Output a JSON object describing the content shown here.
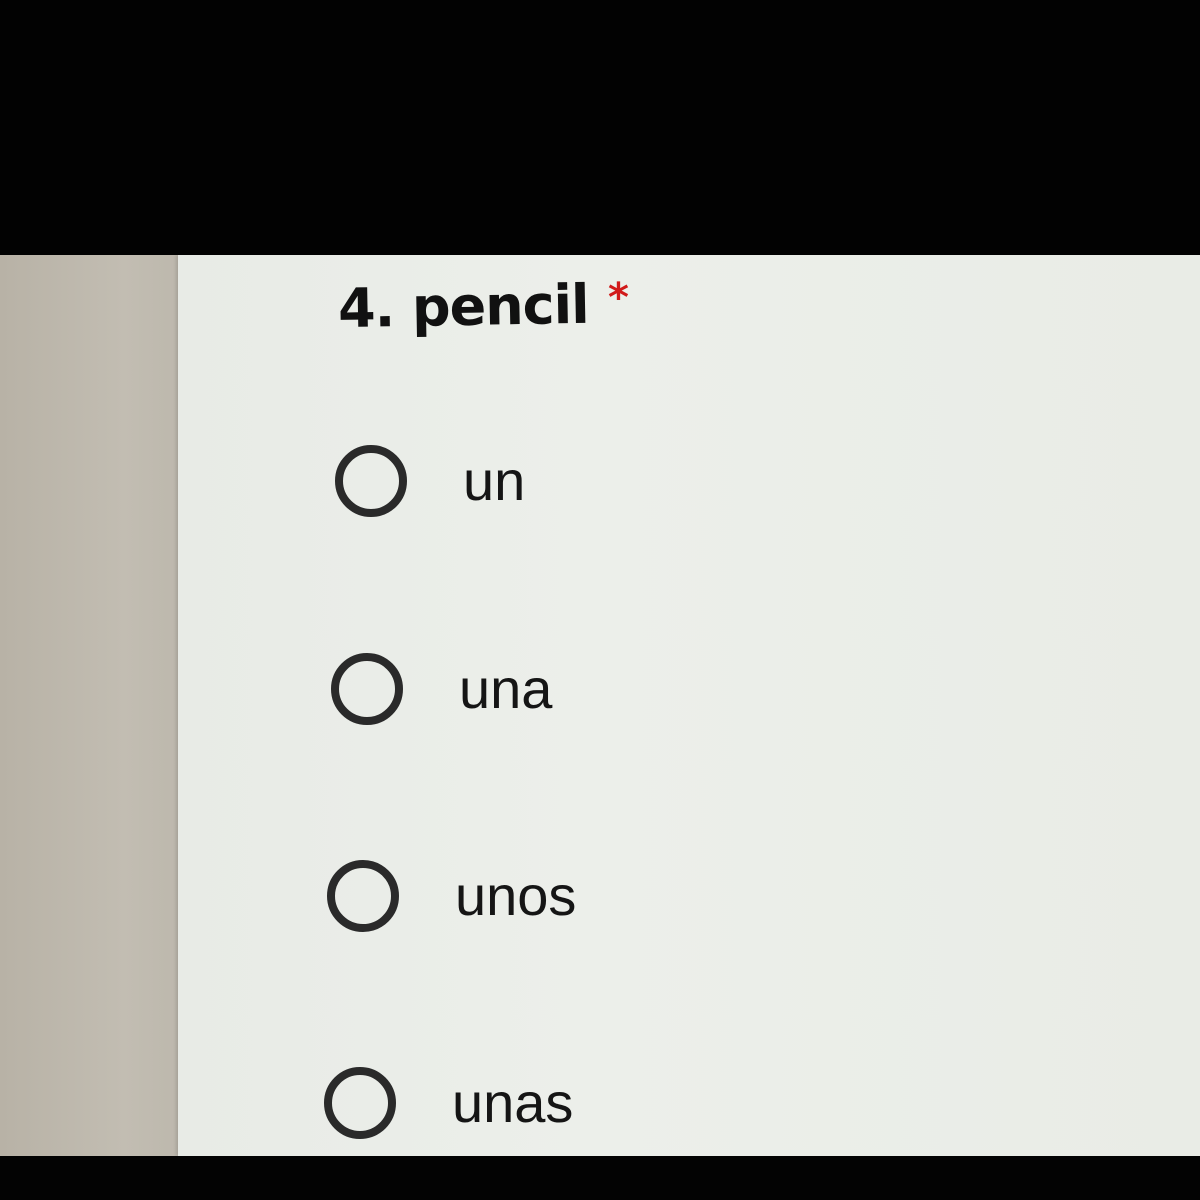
{
  "question": {
    "title": "4. pencil",
    "required_marker": "*"
  },
  "options": [
    {
      "label": "un",
      "selected": false
    },
    {
      "label": "una",
      "selected": false
    },
    {
      "label": "unos",
      "selected": false
    },
    {
      "label": "unas",
      "selected": false
    }
  ],
  "colors": {
    "card_background": "#ecefea",
    "page_margin": "#c2bdb2",
    "required": "#d11a1a",
    "text": "#151515",
    "radio_border": "#2a2a2a"
  }
}
